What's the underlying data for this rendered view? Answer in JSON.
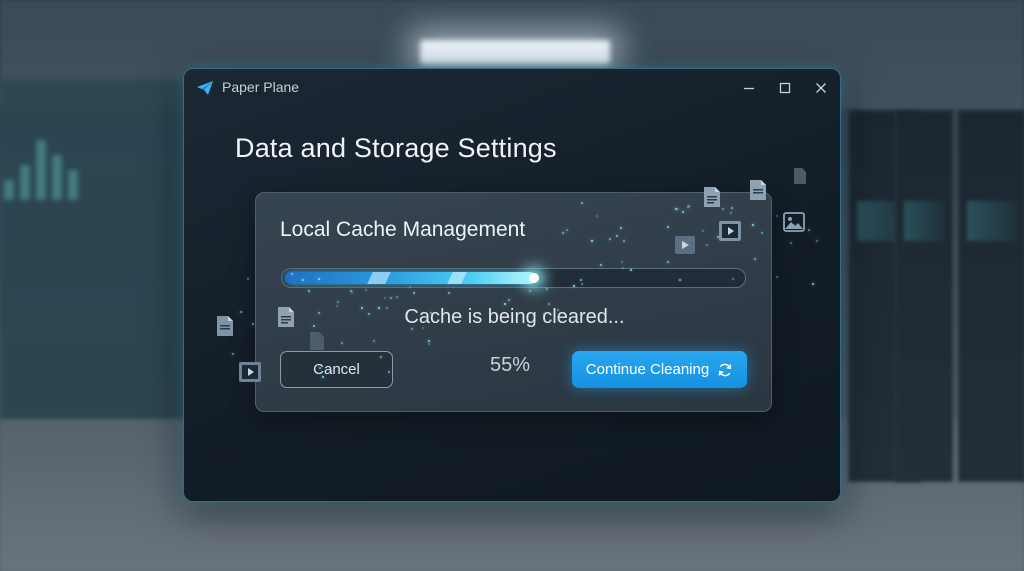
{
  "window": {
    "app_name": "Paper Plane",
    "controls": {
      "minimize": "minimize-icon",
      "maximize": "maximize-icon",
      "close": "close-icon"
    }
  },
  "page": {
    "title": "Data and Storage Settings"
  },
  "cache_card": {
    "title": "Local Cache Management",
    "status": "Cache is being cleared...",
    "progress_percent": 55,
    "progress_label": "55%",
    "cancel_label": "Cancel",
    "continue_label": "Continue Cleaning",
    "continue_icon": "refresh-icon"
  },
  "colors": {
    "accent": "#1d9be8",
    "window_border": "#3a6b82",
    "progress_glow": "#4fd0f2"
  }
}
